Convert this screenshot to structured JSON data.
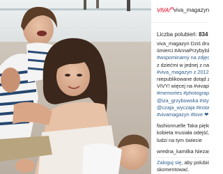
{
  "sidebar": {
    "brand_logo": "VIVA!",
    "brand_logo_sup": "PL",
    "username": "viva_magazyn",
    "likes_label": "Liczba polubień:",
    "likes_count": "834",
    "caption_user": "viva_magazyn",
    "caption_lines": [
      " Dziś druga",
      "śmierci #AnnaPrzybylska",
      "#wspominamy na zdjęciu",
      "z dziećmi w jednej z nas",
      "#viva_magazyn z 2012",
      "niepublikowane dotąd z",
      "VIVY! więcej na #vivapl",
      "#memories #photography",
      "@iza_grzybowska #stylist",
      "@czaja_wyczaja #instagram",
      "#vivamagazyn #love ❤"
    ],
    "comment1_user": "fashionruelle",
    "comment1_lines": [
      " Taka piękna",
      "kobieta musiała odejść,",
      "ludzi na tym świecie"
    ],
    "comment2_user": "wredna_kamilka",
    "comment2_text": " Niezas",
    "login_link": "Zaloguj się",
    "login_text_1": ", aby polubić",
    "login_text_2": "skomentować."
  },
  "colors": {
    "brand": "#e8455a",
    "link": "#2c5c8c",
    "text": "#262626"
  },
  "photo": {
    "description_icon": "family-beach-photo"
  }
}
